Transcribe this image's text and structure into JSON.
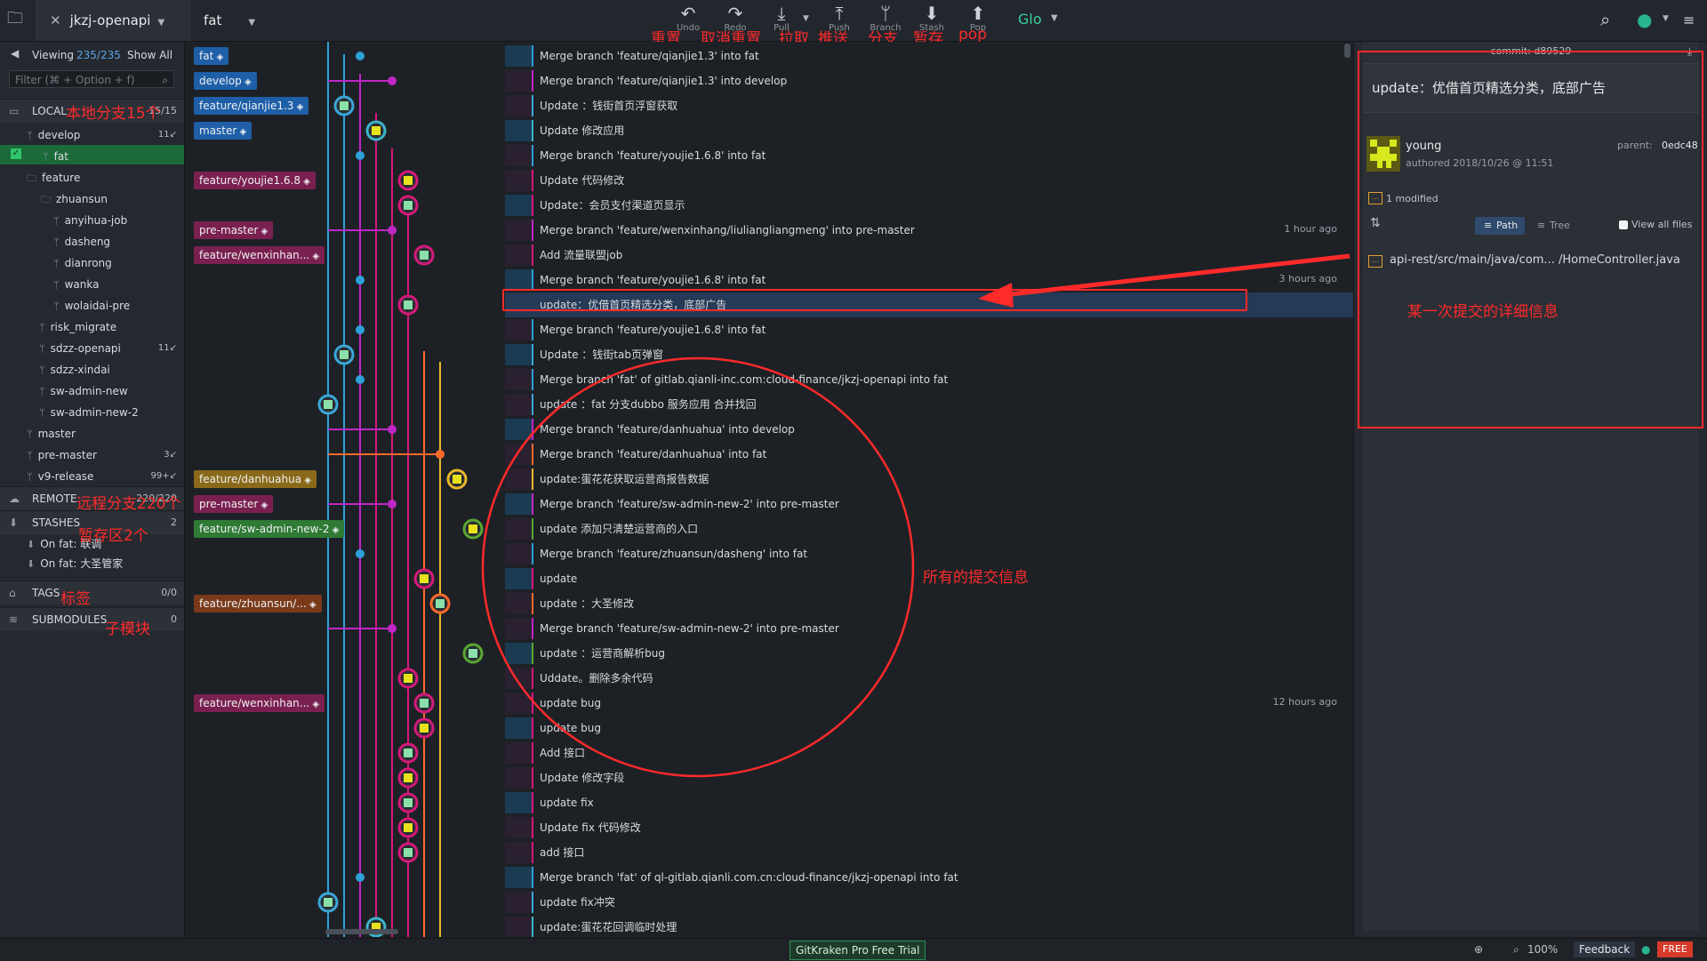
{
  "toolbar": {
    "repo": "jkzj-openapi",
    "branch": "fat",
    "buttons": [
      {
        "label": "Undo",
        "icon": "↶"
      },
      {
        "label": "Redo",
        "icon": "↷"
      },
      {
        "label": "Pull",
        "icon": "⤓"
      },
      {
        "label": "Push",
        "icon": "⤒"
      },
      {
        "label": "Branch",
        "icon": "ᛘ"
      },
      {
        "label": "Stash",
        "icon": "⬇"
      },
      {
        "label": "Pop",
        "icon": "⬆"
      }
    ],
    "glo": "Glo"
  },
  "annotations": {
    "undo": "重置",
    "redo": "取消重置",
    "pull": "拉取",
    "push": "推送",
    "branch": "分支",
    "stash": "暂存",
    "pop": "pop",
    "local": "本地分支15个",
    "remote": "远程分支220个",
    "stashes": "暂存区2个",
    "tags": "标签",
    "submodules": "子模块",
    "commits": "所有的提交信息",
    "detail": "某一次提交的详细信息"
  },
  "sidebar": {
    "viewing_prefix": "Viewing",
    "viewing_count": "235/235",
    "show_all": "Show All",
    "filter_placeholder": "Filter (⌘ + Option + f)",
    "local_label": "LOCAL",
    "local_count": "15/15",
    "remote_label": "REMOTE",
    "remote_count": "220/220",
    "stashes_label": "STASHES",
    "stashes_count": "2",
    "tags_label": "TAGS",
    "tags_count": "0/0",
    "submodules_label": "SUBMODULES",
    "submodules_count": "0",
    "local_items": [
      {
        "label": "develop",
        "ahead": "11↙"
      },
      {
        "label": "fat",
        "ahead": ""
      },
      {
        "label": "feature",
        "ahead": ""
      },
      {
        "label": "zhuansun",
        "ahead": ""
      },
      {
        "label": "anyihua-job",
        "ahead": ""
      },
      {
        "label": "dasheng",
        "ahead": ""
      },
      {
        "label": "dianrong",
        "ahead": ""
      },
      {
        "label": "wanka",
        "ahead": ""
      },
      {
        "label": "wolaidai-pre",
        "ahead": ""
      },
      {
        "label": "risk_migrate",
        "ahead": ""
      },
      {
        "label": "sdzz-openapi",
        "ahead": "11↙"
      },
      {
        "label": "sdzz-xindai",
        "ahead": ""
      },
      {
        "label": "sw-admin-new",
        "ahead": ""
      },
      {
        "label": "sw-admin-new-2",
        "ahead": ""
      },
      {
        "label": "master",
        "ahead": ""
      },
      {
        "label": "pre-master",
        "ahead": "3↙"
      },
      {
        "label": "v9-release",
        "ahead": "99+↙"
      }
    ],
    "stash_items": [
      "On fat: 联调",
      "On fat: 大圣管家"
    ]
  },
  "commits": [
    {
      "label": "fat",
      "msg": "Merge branch 'feature/qianjie1.3' into fat",
      "time": ""
    },
    {
      "label": "develop",
      "msg": "Merge branch 'feature/qianjie1.3' into develop",
      "time": ""
    },
    {
      "label": "feature/qianjie1.3",
      "msg": "Update ：钱街首页浮窗获取",
      "time": ""
    },
    {
      "label": "master",
      "msg": "Update 修改应用",
      "time": ""
    },
    {
      "label": "",
      "msg": "Merge branch 'feature/youjie1.6.8' into fat",
      "time": ""
    },
    {
      "label": "feature/youjie1.6.8",
      "msg": "Update 代码修改",
      "time": ""
    },
    {
      "label": "",
      "msg": "Update：会员支付渠道页显示",
      "time": ""
    },
    {
      "label": "pre-master",
      "msg": "Merge branch 'feature/wenxinhang/liuliangliangmeng' into pre-master",
      "time": "1 hour ago"
    },
    {
      "label": "feature/wenxinhan...",
      "msg": "Add 流量联盟job",
      "time": ""
    },
    {
      "label": "",
      "msg": "Merge branch 'feature/youjie1.6.8' into fat",
      "time": "3 hours ago"
    },
    {
      "label": "",
      "msg": "update：优借首页精选分类，底部广告",
      "time": ""
    },
    {
      "label": "",
      "msg": "Merge branch 'feature/youjie1.6.8' into fat",
      "time": ""
    },
    {
      "label": "",
      "msg": "Update ：钱街tab页弹窗",
      "time": ""
    },
    {
      "label": "",
      "msg": "Merge branch 'fat' of gitlab.qianli-inc.com:cloud-finance/jkzj-openapi into fat",
      "time": ""
    },
    {
      "label": "",
      "msg": "update ：fat 分支dubbo 服务应用 合并找回",
      "time": ""
    },
    {
      "label": "",
      "msg": "Merge branch 'feature/danhuahua' into develop",
      "time": ""
    },
    {
      "label": "",
      "msg": "Merge branch 'feature/danhuahua' into fat",
      "time": ""
    },
    {
      "label": "feature/danhuahua",
      "msg": "update:蛋花花获取运营商报告数据",
      "time": ""
    },
    {
      "label": "pre-master",
      "msg": "Merge branch 'feature/sw-admin-new-2' into pre-master",
      "time": ""
    },
    {
      "label": "feature/sw-admin-new-2",
      "msg": "update 添加只清楚运营商的入口",
      "time": ""
    },
    {
      "label": "",
      "msg": "Merge branch 'feature/zhuansun/dasheng' into fat",
      "time": ""
    },
    {
      "label": "",
      "msg": "update",
      "time": ""
    },
    {
      "label": "feature/zhuansun/...",
      "msg": "update ：大圣修改",
      "time": ""
    },
    {
      "label": "",
      "msg": "Merge branch 'feature/sw-admin-new-2' into pre-master",
      "time": ""
    },
    {
      "label": "",
      "msg": "update ：运营商解析bug",
      "time": ""
    },
    {
      "label": "",
      "msg": "Uddate。删除多余代码",
      "time": ""
    },
    {
      "label": "feature/wenxinhan...",
      "msg": "update bug",
      "time": "12 hours ago"
    },
    {
      "label": "",
      "msg": "update bug",
      "time": ""
    },
    {
      "label": "",
      "msg": "Add 接口",
      "time": ""
    },
    {
      "label": "",
      "msg": "Update 修改字段",
      "time": ""
    },
    {
      "label": "",
      "msg": "update fix",
      "time": ""
    },
    {
      "label": "",
      "msg": "Update fix 代码修改",
      "time": ""
    },
    {
      "label": "",
      "msg": "add 接口",
      "time": ""
    },
    {
      "label": "",
      "msg": "Merge branch 'fat' of ql-gitlab.qianli.com.cn:cloud-finance/jkzj-openapi into fat",
      "time": ""
    },
    {
      "label": "",
      "msg": "update fix冲突",
      "time": ""
    },
    {
      "label": "",
      "msg": "update:蛋花花回调临时处理",
      "time": ""
    }
  ],
  "detail": {
    "commit_label": "commit:",
    "commit_sha": "d89529",
    "subject": "update：优借首页精选分类，底部广告",
    "author": "young",
    "parent_label": "parent:",
    "parent_sha": "0edc48",
    "authored": "authored 2018/10/26 @ 11:51",
    "modified": "1 modified",
    "path_label": "Path",
    "tree_label": "Tree",
    "view_all": "View all files",
    "file": "api-rest/src/main/java/com... /HomeController.java"
  },
  "status": {
    "trial": "GitKraken Pro Free Trial",
    "zoom": "100%",
    "feedback": "Feedback",
    "plan": "FREE"
  },
  "colors": {
    "accent_red": "#ff2a2a",
    "selected_row": "#2e4b73",
    "fat_green": "#1b6a3a"
  }
}
